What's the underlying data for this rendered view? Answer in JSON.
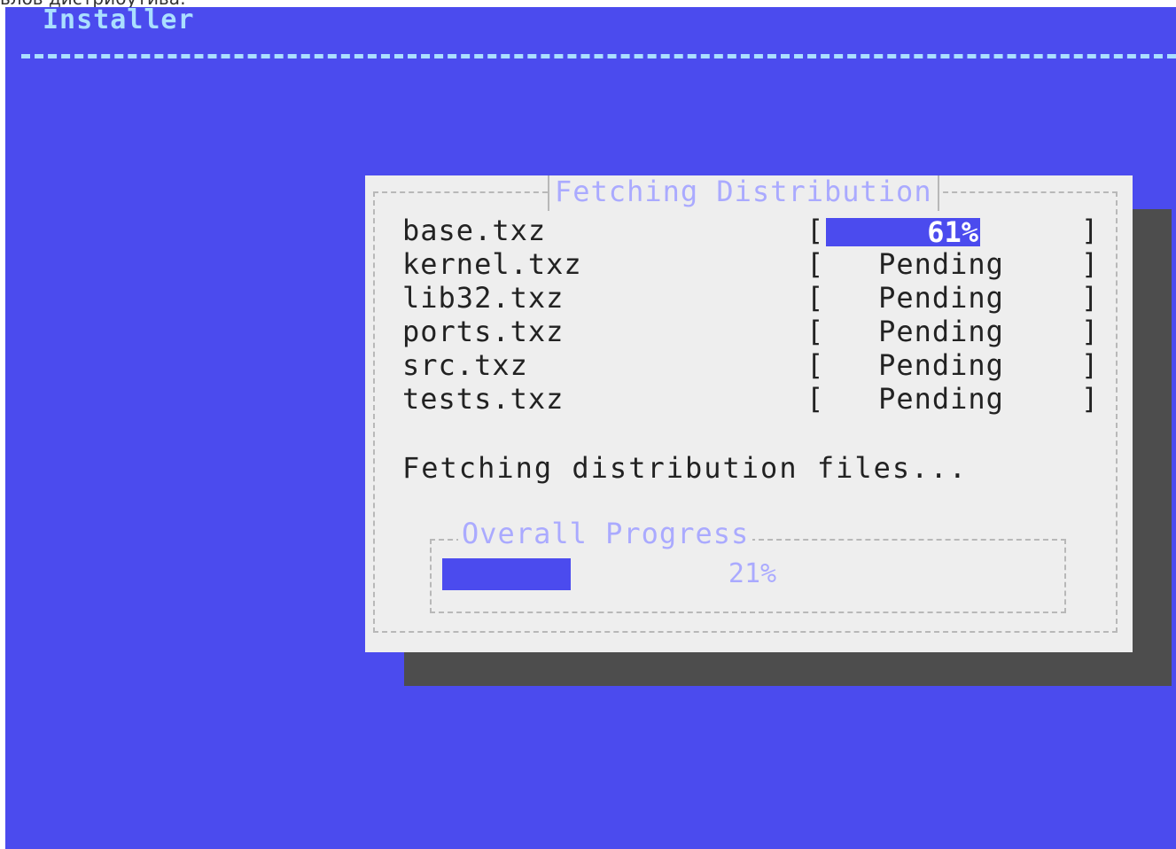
{
  "caption": "ьлов дистрибутива:",
  "header": {
    "title": "Installer"
  },
  "dialog": {
    "title": "Fetching Distribution",
    "files": [
      {
        "name": "base.txz",
        "status": "61%",
        "progress": 0.61
      },
      {
        "name": "kernel.txz",
        "status": "Pending"
      },
      {
        "name": "lib32.txz",
        "status": "Pending"
      },
      {
        "name": "ports.txz",
        "status": "Pending"
      },
      {
        "name": "src.txz",
        "status": "Pending"
      },
      {
        "name": "tests.txz",
        "status": "Pending"
      }
    ],
    "brackets": {
      "open": "[",
      "close": "]"
    },
    "message": "Fetching distribution files...",
    "overall": {
      "title": "Overall Progress",
      "percent_label": "21%",
      "progress": 0.21
    }
  },
  "colors": {
    "background": "#4b4bee",
    "dialog": "#eeeeee",
    "shadow": "#4d4d4d",
    "title_text": "#aadfff",
    "frame_title": "#aaaaff"
  }
}
